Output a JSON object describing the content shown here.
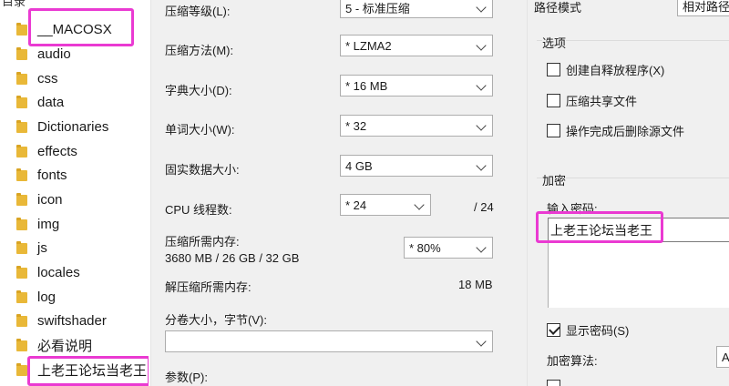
{
  "tree": {
    "header": "目录",
    "items": [
      {
        "label": "__MACOSX"
      },
      {
        "label": "audio"
      },
      {
        "label": "css"
      },
      {
        "label": "data"
      },
      {
        "label": "Dictionaries"
      },
      {
        "label": "effects"
      },
      {
        "label": "fonts"
      },
      {
        "label": "icon"
      },
      {
        "label": "img"
      },
      {
        "label": "js"
      },
      {
        "label": "locales"
      },
      {
        "label": "log"
      },
      {
        "label": "swiftshader"
      },
      {
        "label": "必看说明"
      },
      {
        "label": "上老王论坛当老王"
      }
    ]
  },
  "settings": {
    "compression_level": {
      "label": "压缩等级(L):",
      "value": "5 - 标准压缩"
    },
    "compression_method": {
      "label": "压缩方法(M):",
      "value": "* LZMA2"
    },
    "dictionary_size": {
      "label": "字典大小(D):",
      "value": "* 16 MB"
    },
    "word_size": {
      "label": "单词大小(W):",
      "value": "* 32"
    },
    "solid_block_size": {
      "label": "固实数据大小:",
      "value": "4 GB"
    },
    "cpu_threads": {
      "label": "CPU 线程数:",
      "value": "* 24",
      "total": "/ 24"
    },
    "memory_compress": {
      "label": "压缩所需内存:",
      "value": "3680 MB / 26 GB / 32 GB",
      "percent": "* 80%"
    },
    "memory_decompress": {
      "label": "解压缩所需内存:",
      "value": "18 MB"
    },
    "volume_size": {
      "label": "分卷大小，字节(V):",
      "value": ""
    },
    "parameters": {
      "label": "参数(P):"
    }
  },
  "right": {
    "path_mode_label": "路径模式",
    "path_mode_value": "相对路径",
    "options_title": "选项",
    "options": [
      {
        "label": "创建自释放程序(X)",
        "checked": false
      },
      {
        "label": "压缩共享文件",
        "checked": false
      },
      {
        "label": "操作完成后删除源文件",
        "checked": false
      }
    ],
    "encryption_title": "加密",
    "password_label": "输入密码:",
    "password_value": "上老王论坛当老王",
    "show_password": {
      "label": "显示密码(S)",
      "checked": true
    },
    "encryption_method_label": "加密算法:",
    "encryption_method_value": "A"
  },
  "colors": {
    "highlight": "#ea3ad2",
    "folder": "#e9b838",
    "dialog_bg": "#f0f0f0"
  }
}
